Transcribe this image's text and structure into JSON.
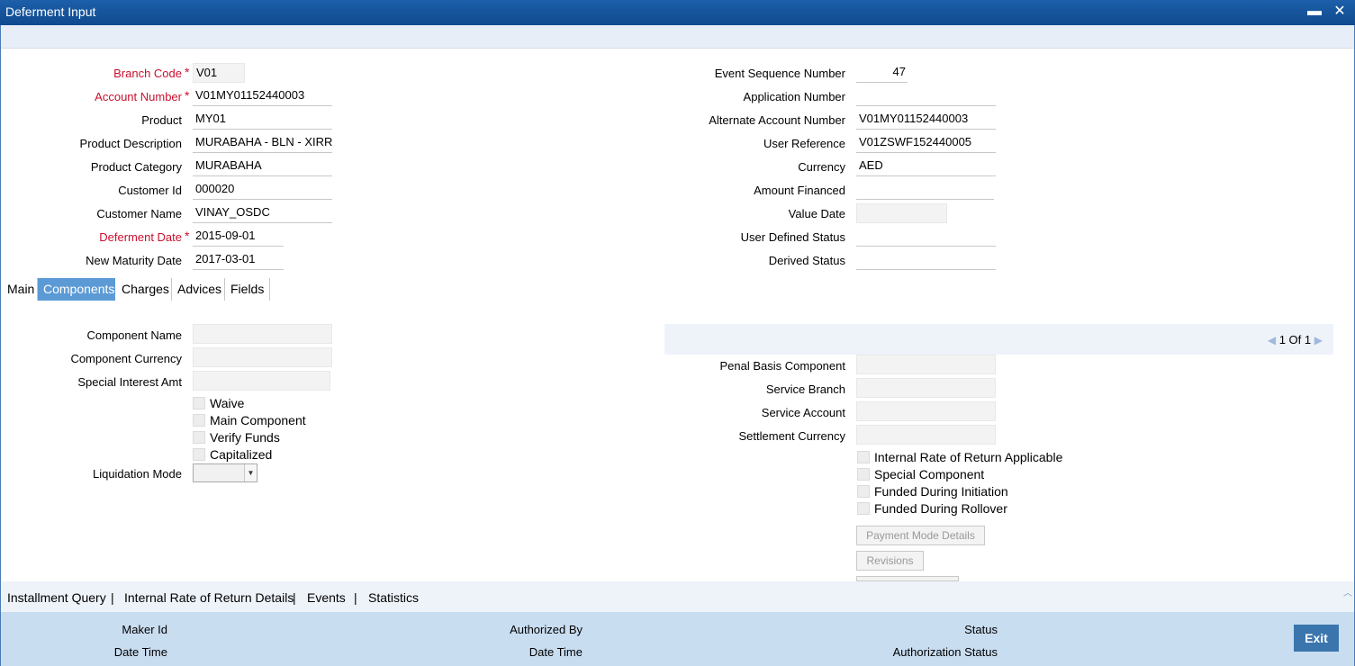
{
  "window": {
    "title": "Deferment Input",
    "minimize_label": "▬",
    "close_label": "✕"
  },
  "header_left": {
    "branch_code": {
      "label": "Branch Code",
      "value": "V01"
    },
    "account_number": {
      "label": "Account Number",
      "value": "V01MY01152440003"
    },
    "product": {
      "label": "Product",
      "value": "MY01"
    },
    "product_description": {
      "label": "Product Description",
      "value": "MURABAHA - BLN - XIRR"
    },
    "product_category": {
      "label": "Product Category",
      "value": "MURABAHA"
    },
    "customer_id": {
      "label": "Customer Id",
      "value": "000020"
    },
    "customer_name": {
      "label": "Customer Name",
      "value": "VINAY_OSDC"
    },
    "deferment_date": {
      "label": "Deferment Date",
      "value": "2015-09-01"
    },
    "new_maturity_date": {
      "label": "New Maturity Date",
      "value": "2017-03-01"
    }
  },
  "header_right": {
    "event_sequence_number": {
      "label": "Event Sequence Number",
      "value": "47"
    },
    "application_number": {
      "label": "Application Number",
      "value": ""
    },
    "alternate_account_number": {
      "label": "Alternate Account Number",
      "value": "V01MY01152440003"
    },
    "user_reference": {
      "label": "User Reference",
      "value": "V01ZSWF152440005"
    },
    "currency": {
      "label": "Currency",
      "value": "AED"
    },
    "amount_financed": {
      "label": "Amount Financed",
      "value": ""
    },
    "value_date": {
      "label": "Value Date",
      "value": ""
    },
    "user_defined_status": {
      "label": "User Defined Status",
      "value": ""
    },
    "derived_status": {
      "label": "Derived Status",
      "value": ""
    }
  },
  "tabs": [
    {
      "label": "Main",
      "active": false
    },
    {
      "label": "Components",
      "active": true
    },
    {
      "label": "Charges",
      "active": false
    },
    {
      "label": "Advices",
      "active": false
    },
    {
      "label": "Fields",
      "active": false
    }
  ],
  "components_left": {
    "component_name": {
      "label": "Component Name",
      "value": ""
    },
    "component_currency": {
      "label": "Component Currency",
      "value": ""
    },
    "special_interest_amt": {
      "label": "Special Interest Amt",
      "value": ""
    },
    "checkboxes": [
      "Waive",
      "Main Component",
      "Verify Funds",
      "Capitalized"
    ],
    "liquidation_mode": {
      "label": "Liquidation Mode",
      "value": ""
    }
  },
  "pager": {
    "current": "1",
    "of_label": "Of",
    "total": "1"
  },
  "components_right": {
    "penal_basis_component": {
      "label": "Penal Basis Component",
      "value": ""
    },
    "service_branch": {
      "label": "Service Branch",
      "value": ""
    },
    "service_account": {
      "label": "Service Account",
      "value": ""
    },
    "settlement_currency": {
      "label": "Settlement Currency",
      "value": ""
    },
    "checkboxes": [
      "Internal Rate of Return Applicable",
      "Special Component",
      "Funded During Initiation",
      "Funded During Rollover"
    ],
    "buttons": {
      "payment_mode_details": "Payment Mode Details",
      "revisions": "Revisions"
    }
  },
  "link_bar": {
    "installment_query": "Installment Query",
    "irr_details": "Internal Rate of Return Details",
    "events": "Events",
    "statistics": "Statistics",
    "separator": "|"
  },
  "footer": {
    "maker_id": "Maker Id",
    "maker_date_time": "Date Time",
    "authorized_by": "Authorized By",
    "auth_date_time": "Date Time",
    "status": "Status",
    "authorization_status": "Authorization Status",
    "exit_label": "Exit"
  },
  "colors": {
    "title_bar": "#1d5faa",
    "active_tab": "#5c9ad5",
    "required_label": "#c8102e",
    "footer": "#c9ddf1",
    "exit_button": "#3a76ad"
  }
}
